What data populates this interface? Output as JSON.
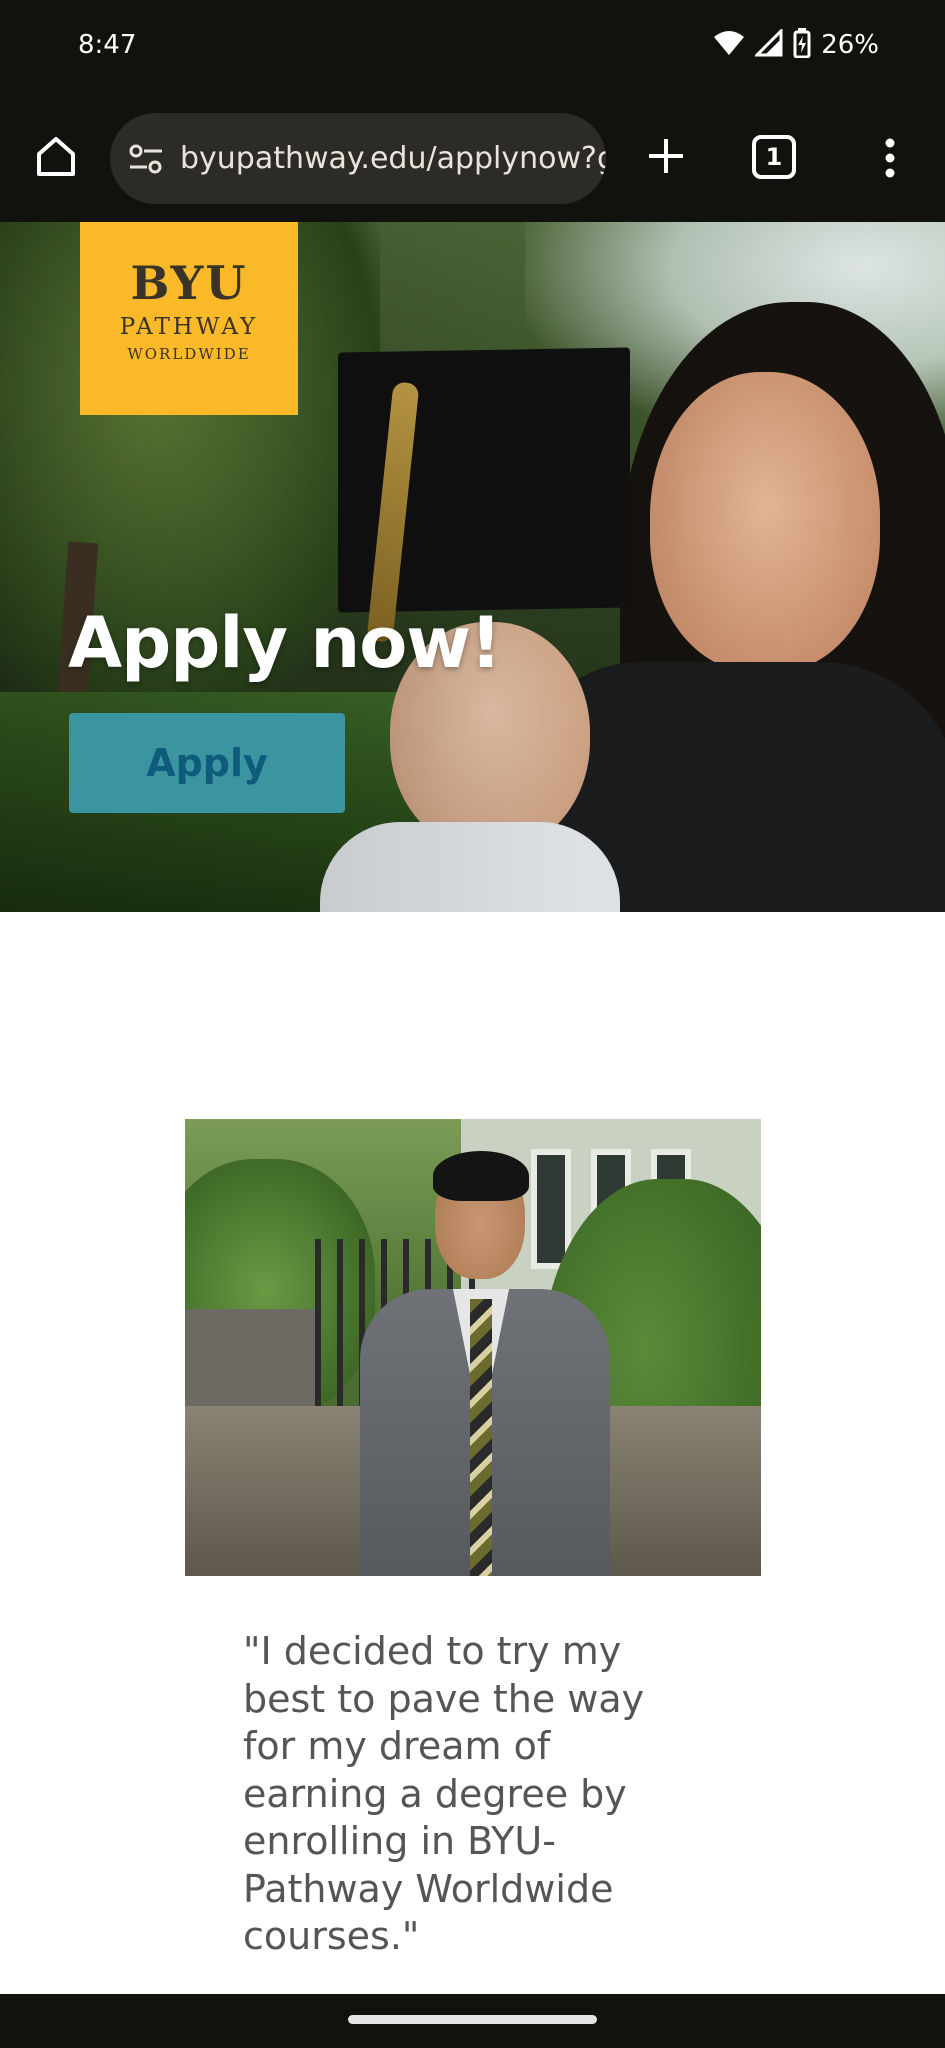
{
  "status_bar": {
    "time": "8:47",
    "battery": "26%",
    "icons": [
      "wifi-icon",
      "signal-icon",
      "battery-charging-icon"
    ]
  },
  "browser": {
    "url": "byupathway.edu/applynow?g",
    "tab_count": "1",
    "icons": [
      "home-icon",
      "tune-icon",
      "plus-icon",
      "more-vert-icon"
    ]
  },
  "hero": {
    "logo": {
      "line1": "BYU",
      "line2": "PATHWAY",
      "line3": "WORLDWIDE"
    },
    "title": "Apply now!",
    "apply_label": "Apply",
    "colors": {
      "logo_bg": "#f9b928",
      "button_bg": "#3b95a0",
      "button_text": "#0f5b7c"
    }
  },
  "testimonial": {
    "quote": "\"I decided to try my best to pave the way for my dream of earning a degree by enrolling in BYU-Pathway Worldwide courses.\""
  }
}
